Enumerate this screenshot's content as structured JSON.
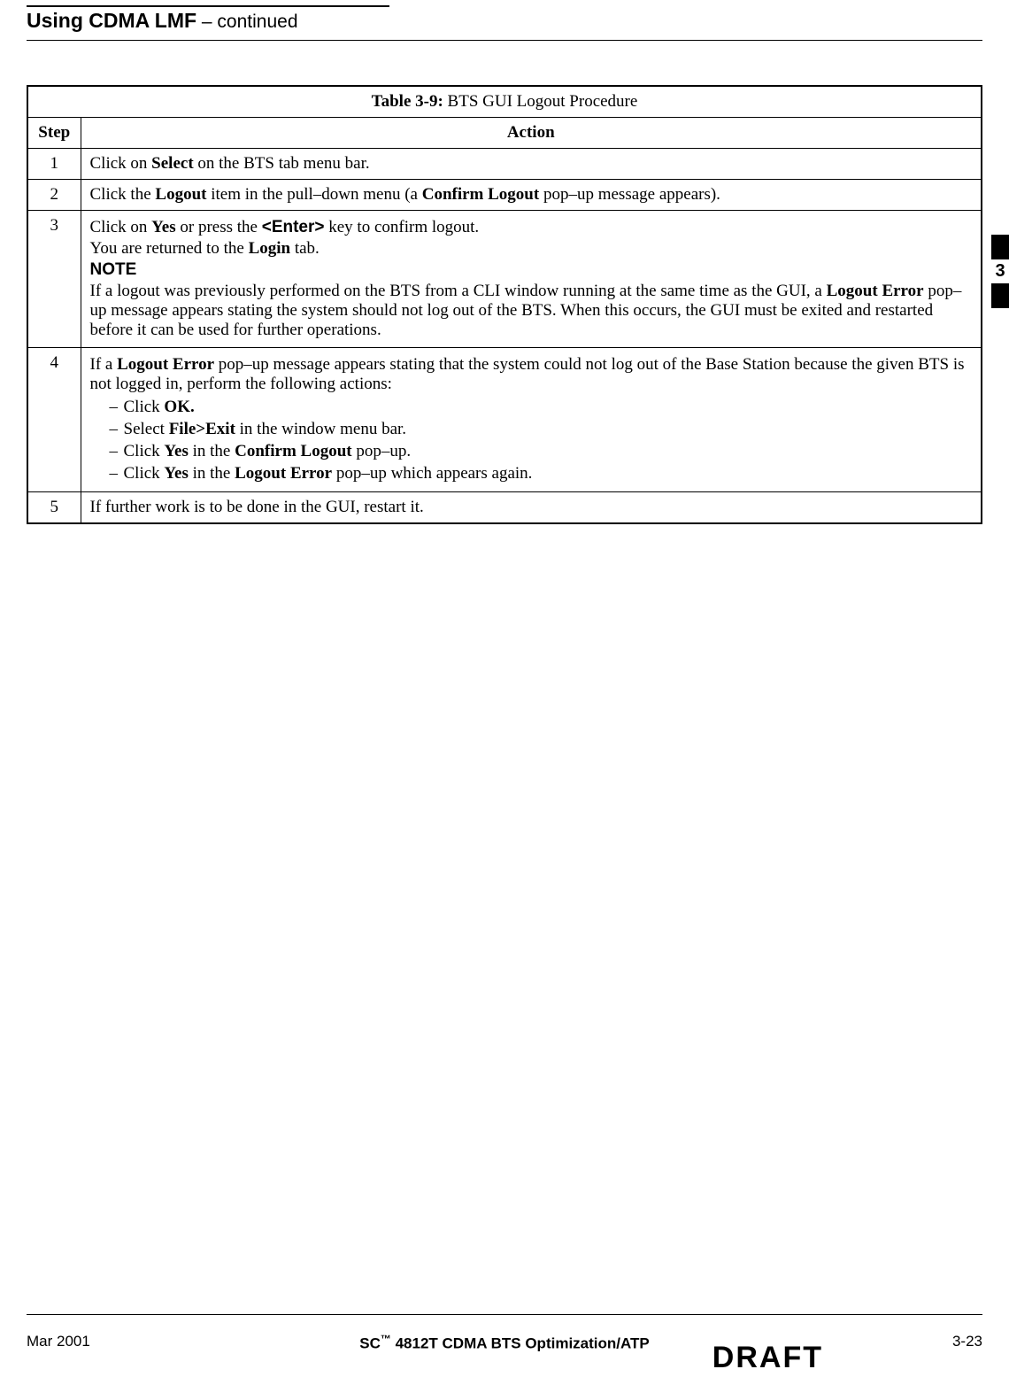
{
  "header": {
    "title": "Using CDMA LMF",
    "continued": " – continued"
  },
  "table": {
    "caption_prefix": "Table 3-9:",
    "caption_text": " BTS GUI Logout Procedure",
    "col_step": "Step",
    "col_action": "Action",
    "rows": {
      "r1": {
        "step": "1",
        "a1": "Click on ",
        "a2": "Select",
        "a3": " on the BTS tab menu bar."
      },
      "r2": {
        "step": "2",
        "a1": "Click the ",
        "a2": "Logout",
        "a3": " item in the pull–down menu (a ",
        "a4": "Confirm Logout",
        "a5": " pop–up message appears)."
      },
      "r3": {
        "step": "3",
        "l1a": "Click on ",
        "l1b": "Yes",
        "l1c": " or press the ",
        "l1d": "<Enter>",
        "l1e": " key to confirm logout.",
        "l2a": "You are returned to the ",
        "l2b": "Login",
        "l2c": " tab.",
        "note": "NOTE",
        "l3a": "If a logout was previously performed on the BTS from a CLI window running at the same time as the GUI, a ",
        "l3b": "Logout Error",
        "l3c": " pop–up message appears stating the system should not log out of the BTS. When this occurs, the GUI must be exited and restarted before it can be used for further operations."
      },
      "r4": {
        "step": "4",
        "l1a": "If a ",
        "l1b": "Logout Error",
        "l1c": " pop–up message appears stating that the system could not log out of the Base Station because the given BTS is not logged in, perform the following actions:",
        "b1a": "Click ",
        "b1b": "OK.",
        "b2a": "Select ",
        "b2b": "File>Exit",
        "b2c": " in the window menu bar.",
        "b3a": "Click ",
        "b3b": "Yes",
        "b3c": " in the ",
        "b3d": "Confirm Logout",
        "b3e": " pop–up.",
        "b4a": "Click ",
        "b4b": "Yes",
        "b4c": " in the ",
        "b4d": "Logout Error",
        "b4e": " pop–up which appears again."
      },
      "r5": {
        "step": "5",
        "a1": "If further work is to be done in the GUI, restart it."
      }
    }
  },
  "side_tab": "3",
  "footer": {
    "date": "Mar 2001",
    "title_prefix": "SC",
    "tm": "™",
    "title_suffix": " 4812T CDMA BTS Optimization/ATP",
    "page": "3-23",
    "draft": "DRAFT"
  }
}
